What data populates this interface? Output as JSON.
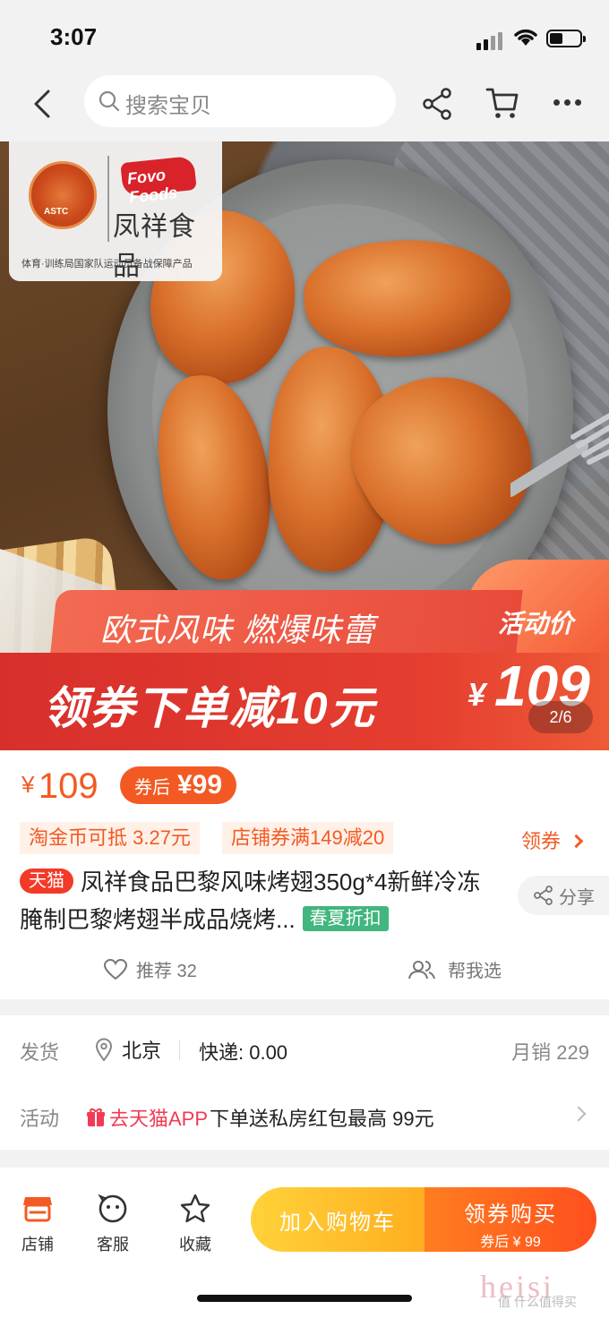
{
  "status": {
    "time": "3:07"
  },
  "nav": {
    "search_placeholder": "搜索宝贝"
  },
  "hero": {
    "brand_name": "凤祥食品",
    "brand_logo_text": "Fovo Foods",
    "emblem_text": "ASTC",
    "slogan": "体育·训练局国家队运动员备战保障产品"
  },
  "promo": {
    "tagline": "欧式风味 燃爆味蕾",
    "coupon_text": "领券下单减10元",
    "activity_label": "活动价",
    "activity_currency": "¥",
    "activity_price": "109",
    "pager": "2/6"
  },
  "price": {
    "currency": "¥",
    "value": "109",
    "after_coupon_label": "券后",
    "after_coupon_value": "¥99"
  },
  "tags": {
    "gold_coin": "淘金币可抵 3.27元",
    "shop_coupon": "店铺券满149减20",
    "get_coupon": "领券"
  },
  "product": {
    "badge": "天猫",
    "title": "凤祥食品巴黎风味烤翅350g*4新鲜冷冻腌制巴黎烤翅半成品烧烤...",
    "season_badge": "春夏折扣",
    "share_label": "分享",
    "recommend_label": "推荐 32",
    "help_choose_label": "帮我选"
  },
  "shipping": {
    "ship_label": "发货",
    "location": "北京",
    "express": "快递: 0.00",
    "monthly_sales": "月销 229",
    "activity_label": "活动",
    "activity_link": "去天猫APP",
    "activity_desc": "下单送私房红包最高 99元"
  },
  "bottom_bar": {
    "store": "店铺",
    "service": "客服",
    "favorite": "收藏",
    "add_to_cart": "加入购物车",
    "buy_with_coupon": "领券购买",
    "buy_sub": "券后 ¥ 99"
  },
  "watermark": {
    "main": "heisi",
    "sub": "值 什么值得买"
  },
  "colors": {
    "accent": "#f35a23",
    "tmall_red": "#f33a28",
    "season_green": "#41b67e",
    "cart_yellow": "#ffc12a",
    "buy_orange": "#ff5a1e"
  }
}
